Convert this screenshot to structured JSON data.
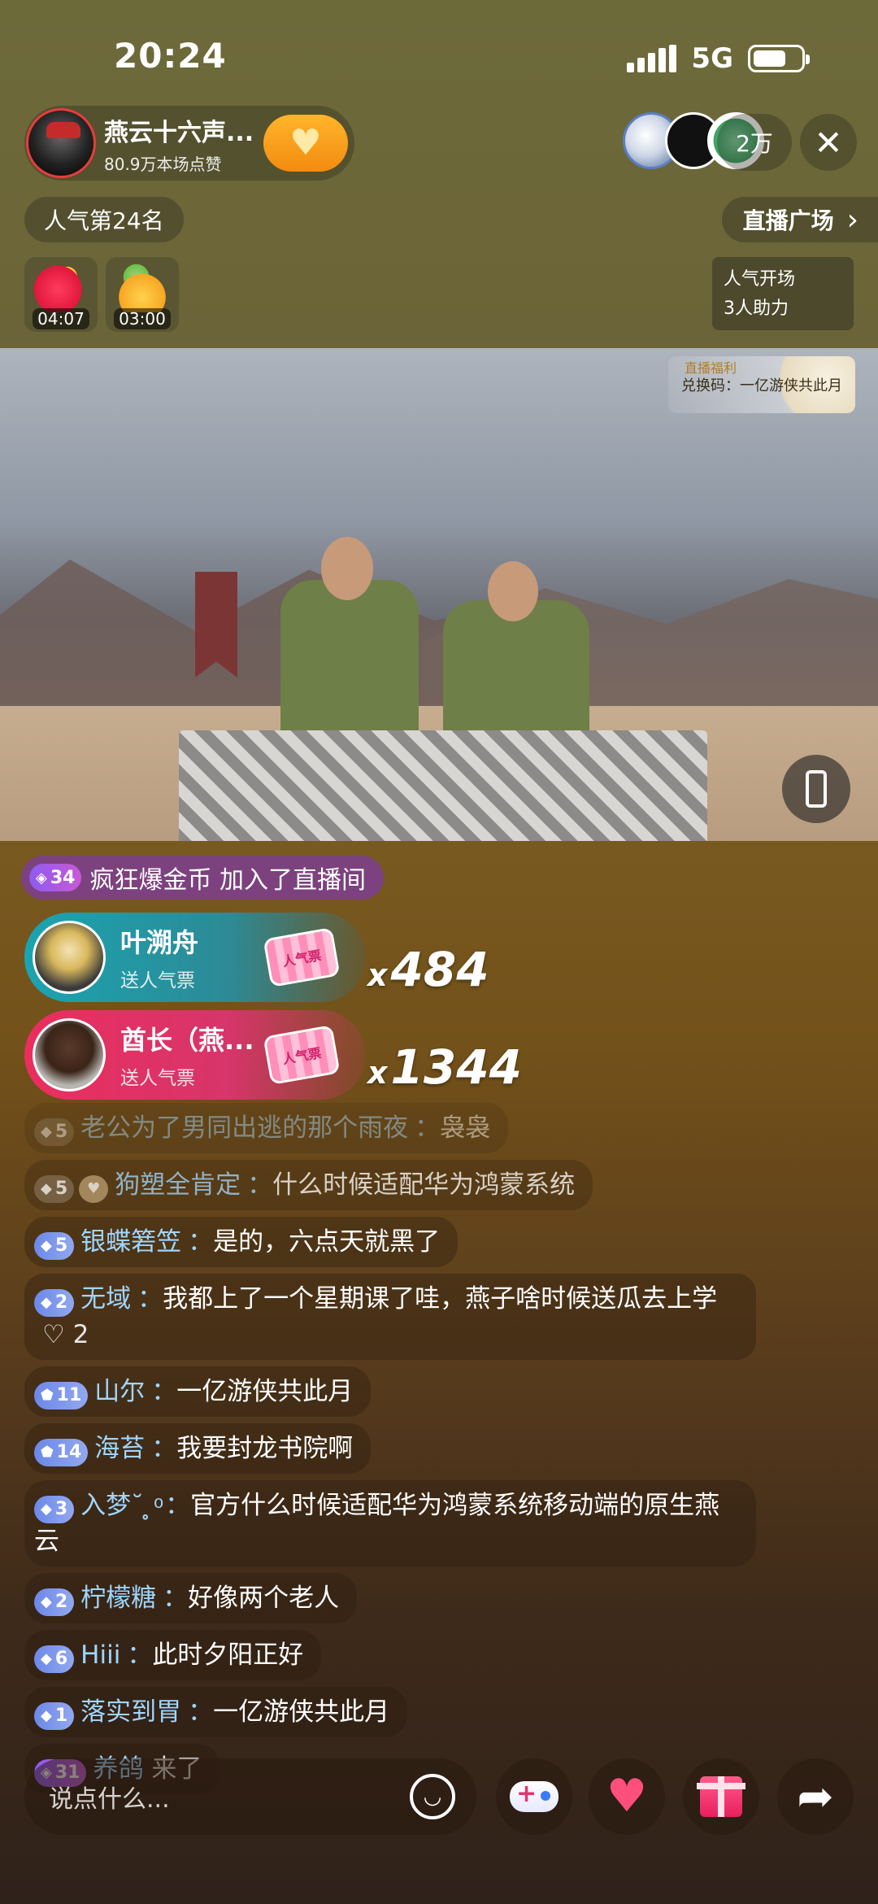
{
  "status": {
    "time": "20:24",
    "network": "5G"
  },
  "host": {
    "name": "燕云十六声...",
    "likes": "80.9万本场点赞"
  },
  "viewers": {
    "count": "2万"
  },
  "rank": "人气第24名",
  "plaza": {
    "label": "直播广场",
    "arrow": "›"
  },
  "gift_timers": [
    "04:07",
    "03:00"
  ],
  "boost": {
    "line1": "人气开场",
    "line2": "3人助力"
  },
  "video": {
    "badge_title": "直播福利",
    "badge_text": "兑换码：一亿游侠共此月"
  },
  "join_banner": {
    "level": "34",
    "text": "疯狂爆金币 加入了直播间"
  },
  "gift_banners": [
    {
      "name": "叶溯舟",
      "sub": "送人气票",
      "ticket": "人气票",
      "count": "484"
    },
    {
      "name": "酋长（燕...",
      "sub": "送人气票",
      "ticket": "人气票",
      "count": "1344"
    }
  ],
  "combo_prefix": "x",
  "chat": [
    {
      "level": "5",
      "name": "老公为了男同出逃的那个雨夜",
      "sep": "：",
      "msg": "袅袅",
      "state": "faded"
    },
    {
      "level": "5",
      "name": "狗塑全肯定",
      "sep": "：",
      "msg": "什么时候适配华为鸿蒙系统",
      "state": "half",
      "fan": true
    },
    {
      "level": "5",
      "name": "银蝶箬笠",
      "sep": "：",
      "msg": "是的，六点天就黑了"
    },
    {
      "level": "2",
      "name": "无域",
      "sep": "：",
      "msg": "我都上了一个星期课了哇，燕子啥时候送瓜去上学",
      "likes": "♡ 2"
    },
    {
      "level": "11",
      "name": "山尔",
      "sep": "：",
      "msg": "一亿游侠共此月"
    },
    {
      "level": "14",
      "name": "海苔",
      "sep": "：",
      "msg": "我要封龙书院啊"
    },
    {
      "level": "3",
      "name": "入梦˘ ̥̥ ͦ",
      "sep": "：",
      "msg": "官方什么时候适配华为鸿蒙系统移动端的原生燕云"
    },
    {
      "level": "2",
      "name": "柠檬糖",
      "sep": "：",
      "msg": "好像两个老人"
    },
    {
      "level": "6",
      "name": "Hiii",
      "sep": "：",
      "msg": "此时夕阳正好"
    },
    {
      "level": "1",
      "name": "落实到胃",
      "sep": "：",
      "msg": "一亿游侠共此月"
    },
    {
      "level": "31",
      "name": "养鸽",
      "sep": "",
      "msg": " 来了",
      "purple": true
    }
  ],
  "input": {
    "placeholder": "说点什么..."
  },
  "icons": {
    "close": "close-icon",
    "emoji": "emoji-icon",
    "game": "gamepad-icon",
    "heart": "heart-icon",
    "gift": "gift-icon",
    "share": "share-icon"
  },
  "colors": {
    "follow": "#f5a020",
    "chat_name": "#9fd6ff",
    "join": "#7d3c96"
  }
}
